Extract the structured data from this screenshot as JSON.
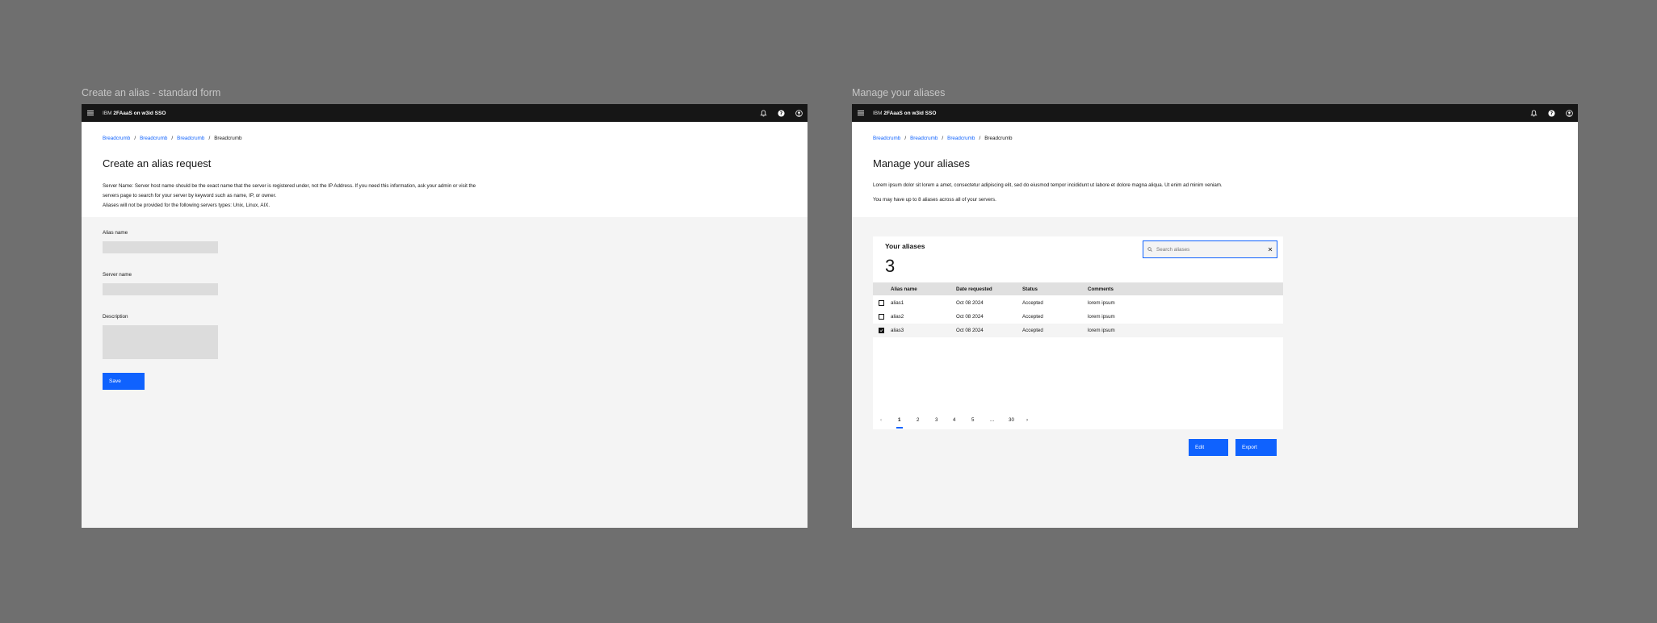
{
  "left": {
    "frame_label": "Create an alias - standard form",
    "shell": {
      "brand_prefix": "IBM",
      "product": "2FAaaS on w3id SSO"
    },
    "breadcrumbs": [
      "Breadcrumb",
      "Breadcrumb",
      "Breadcrumb",
      "Breadcrumb"
    ],
    "title": "Create an alias request",
    "description": [
      "Server Name: Server host name should be the exact name that the server is registered under, not the IP Address. If you need this information, ask your admin or visit the",
      "servers page to search for your server by keyword such as name, IP, or owner.",
      "Aliases will not be provided for the following servers types: Unix, Linux, AIX."
    ],
    "fields": {
      "alias_name_label": "Alias name",
      "server_name_label": "Server name",
      "description_label": "Description"
    },
    "save_label": "Save"
  },
  "right": {
    "frame_label": "Manage your aliases",
    "shell": {
      "brand_prefix": "IBM",
      "product": "2FAaaS on w3id SSO"
    },
    "breadcrumbs": [
      "Breadcrumb",
      "Breadcrumb",
      "Breadcrumb",
      "Breadcrumb"
    ],
    "title": "Manage your aliases",
    "description": [
      "Lorem ipsum dolor sit lorem a amet, consectetur adipiscing elit, sed do eiusmod tempor incididunt ut labore et dolore magna aliqua. Ut enim ad minim veniam.",
      "You may have up to 8 aliases across all of your servers."
    ],
    "table": {
      "title": "Your aliases",
      "count": "3",
      "search_placeholder": "Search aliases",
      "columns": [
        "Alias name",
        "Date requested",
        "Status",
        "Comments"
      ],
      "rows": [
        {
          "alias": "alias1",
          "date": "Oct 08 2024",
          "status": "Accepted",
          "comments": "lorem ipsum",
          "checked": false
        },
        {
          "alias": "alias2",
          "date": "Oct 08 2024",
          "status": "Accepted",
          "comments": "lorem ipsum",
          "checked": false
        },
        {
          "alias": "alias3",
          "date": "Oct 08 2024",
          "status": "Accepted",
          "comments": "lorem ipsum",
          "checked": true
        }
      ],
      "pagination": {
        "prev": "‹",
        "pages": [
          "1",
          "2",
          "3",
          "4",
          "5",
          "...",
          "30"
        ],
        "next": "›",
        "current": "1"
      }
    },
    "edit_label": "Edit",
    "export_label": "Export"
  },
  "colors": {
    "accent": "#0f62fe",
    "shell": "#161616",
    "canvas": "#6f6f6f",
    "surface": "#f4f4f4"
  },
  "icons": [
    "menu-icon",
    "notification-icon",
    "help-icon",
    "user-avatar-icon",
    "search-icon",
    "close-icon",
    "checkmark-icon"
  ]
}
